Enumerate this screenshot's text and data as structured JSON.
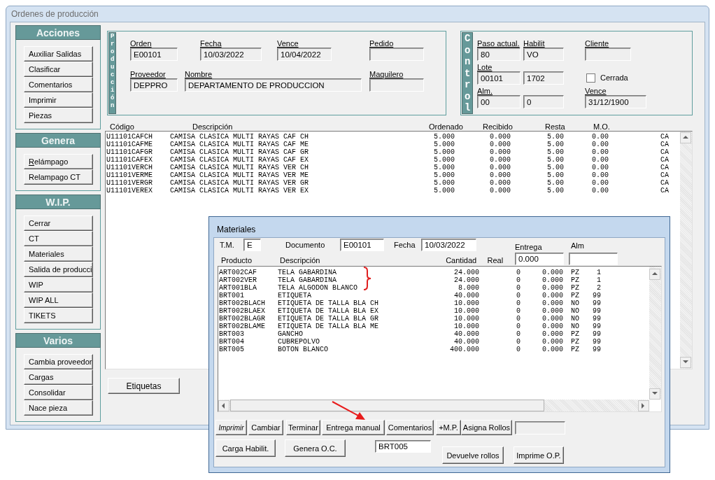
{
  "window": {
    "title": "Ordenes de producción"
  },
  "sidebar": {
    "sections": [
      {
        "title": "Acciones",
        "buttons": [
          {
            "label": "Auxiliar Salidas",
            "mnemonic": false
          },
          {
            "label": "Clasificar",
            "mnemonic": false
          },
          {
            "label": "Comentarios",
            "mnemonic": false
          },
          {
            "label": "Imprimir",
            "mnemonic": false
          },
          {
            "label": "Piezas",
            "mnemonic": false
          }
        ]
      },
      {
        "title": "Genera",
        "buttons": [
          {
            "label": "Relámpago",
            "mnemonic": true
          },
          {
            "label": "Relampago CT",
            "mnemonic": false
          }
        ]
      },
      {
        "title": "W.I.P.",
        "buttons": [
          {
            "label": "Cerrar",
            "mnemonic": false
          },
          {
            "label": "CT",
            "mnemonic": false
          },
          {
            "label": "Materiales",
            "mnemonic": false
          },
          {
            "label": "Salida de producci",
            "mnemonic": false
          },
          {
            "label": "WIP",
            "mnemonic": false
          },
          {
            "label": "WIP ALL",
            "mnemonic": false
          },
          {
            "label": "TIKETS",
            "mnemonic": false
          }
        ]
      },
      {
        "title": "Varios",
        "buttons": [
          {
            "label": "Cambia proveedor",
            "mnemonic": false
          },
          {
            "label": "Cargas",
            "mnemonic": false
          },
          {
            "label": "Consolidar",
            "mnemonic": false
          },
          {
            "label": "Nace pieza",
            "mnemonic": false
          }
        ]
      }
    ]
  },
  "produccion": {
    "label": "Producción",
    "top_fields": [
      {
        "label": "Orden",
        "value": "E00101"
      },
      {
        "label": "Fecha",
        "value": "10/03/2022"
      },
      {
        "label": "Vence",
        "value": "10/04/2022"
      },
      {
        "label": "Pedido"
      }
    ],
    "bottom_fields": [
      {
        "label": "Proveedor",
        "value": "DEPPRO"
      },
      {
        "label": "Nombre",
        "value": "DEPARTAMENTO  DE PRODUCCION"
      },
      {
        "label": "Maquilero"
      }
    ]
  },
  "control": {
    "label": "Control",
    "rows": [
      [
        {
          "kind": "field",
          "label": "Paso actual.",
          "value": "80"
        },
        {
          "kind": "field",
          "label": "Habilit",
          "value": "VO"
        },
        {
          "kind": "field",
          "label": "Cliente"
        }
      ],
      [
        {
          "kind": "field",
          "label": "Lote",
          "value": "00101"
        },
        {
          "kind": "field",
          "value": "1702"
        },
        {
          "kind": "checkbox",
          "label": "Cerrada",
          "checked": false
        }
      ],
      [
        {
          "kind": "field",
          "label": "Alm.",
          "value": "00"
        },
        {
          "kind": "field",
          "value": "0"
        },
        {
          "kind": "field",
          "label": "Vence",
          "value": "31/12/1900"
        }
      ]
    ]
  },
  "table": {
    "columns": [
      "Código",
      "Descripción",
      "Ordenado",
      "Recibido",
      "Resta",
      "M.O."
    ],
    "rows": [
      [
        "U11101CAFCH",
        "CAMISA CLASICA MULTI RAYAS CAF CH",
        "5.000",
        "0.000",
        "5.00",
        "0.00",
        "CA"
      ],
      [
        "U11101CAFME",
        "CAMISA CLASICA MULTI RAYAS CAF ME",
        "5.000",
        "0.000",
        "5.00",
        "0.00",
        "CA"
      ],
      [
        "U11101CAFGR",
        "CAMISA CLASICA MULTI RAYAS CAF GR",
        "5.000",
        "0.000",
        "5.00",
        "0.00",
        "CA"
      ],
      [
        "U11101CAFEX",
        "CAMISA CLASICA MULTI RAYAS CAF EX",
        "5.000",
        "0.000",
        "5.00",
        "0.00",
        "CA"
      ],
      [
        "U11101VERCH",
        "CAMISA CLASICA MULTI RAYAS VER CH",
        "5.000",
        "0.000",
        "5.00",
        "0.00",
        "CA"
      ],
      [
        "U11101VERME",
        "CAMISA CLASICA MULTI RAYAS VER ME",
        "5.000",
        "0.000",
        "5.00",
        "0.00",
        "CA"
      ],
      [
        "U11101VERGR",
        "CAMISA CLASICA MULTI RAYAS VER GR",
        "5.000",
        "0.000",
        "5.00",
        "0.00",
        "CA"
      ],
      [
        "U11101VEREX",
        "CAMISA CLASICA MULTI RAYAS VER EX",
        "5.000",
        "0.000",
        "5.00",
        "0.00",
        "CA"
      ]
    ]
  },
  "footer_button": "Etiquetas",
  "materiales": {
    "title": "Materiales",
    "header": [
      {
        "label": "T.M.",
        "value": "E"
      },
      {
        "label": "Documento",
        "value": "E00101"
      },
      {
        "label": "Fecha",
        "value": "10/03/2022"
      }
    ],
    "entrega": {
      "label": "Entrega",
      "value": "0.000"
    },
    "alm": {
      "label": "Alm"
    },
    "columns": [
      "Producto",
      "Descripción",
      "Cantidad",
      "Real"
    ],
    "rows": [
      [
        "ART002CAF",
        "TELA GABARDINA",
        "24.000",
        "0",
        "0.000",
        "PZ",
        "1"
      ],
      [
        "ART002VER",
        "TELA GABARDINA",
        "24.000",
        "0",
        "0.000",
        "PZ",
        "1"
      ],
      [
        "ART001BLA",
        "TELA ALGODON BLANCO",
        "8.000",
        "0",
        "0.000",
        "PZ",
        "2"
      ],
      [
        "BRT001",
        "ETIQUETA",
        "40.000",
        "0",
        "0.000",
        "PZ",
        "99"
      ],
      [
        "BRT002BLACH",
        "ETIQUETA DE TALLA BLA CH",
        "10.000",
        "0",
        "0.000",
        "NO",
        "99"
      ],
      [
        "BRT002BLAEX",
        "ETIQUETA DE TALLA BLA EX",
        "10.000",
        "0",
        "0.000",
        "NO",
        "99"
      ],
      [
        "BRT002BLAGR",
        "ETIQUETA DE TALLA BLA GR",
        "10.000",
        "0",
        "0.000",
        "NO",
        "99"
      ],
      [
        "BRT002BLAME",
        "ETIQUETA DE TALLA BLA ME",
        "10.000",
        "0",
        "0.000",
        "NO",
        "99"
      ],
      [
        "BRT003",
        "GANCHO",
        "40.000",
        "0",
        "0.000",
        "PZ",
        "99"
      ],
      [
        "BRT004",
        "CUBREPOLVO",
        "40.000",
        "0",
        "0.000",
        "PZ",
        "99"
      ],
      [
        "BRT005",
        "BOTON BLANCO",
        "400.000",
        "0",
        "0.000",
        "PZ",
        "99"
      ]
    ],
    "buttons": [
      {
        "label": "Imprimir",
        "italic": true
      },
      {
        "label": "Cambiar",
        "italic": false
      },
      {
        "label": "Terminar",
        "italic": false
      },
      {
        "label": "Entrega manual",
        "italic": false
      },
      {
        "label": "Comentarios",
        "italic": false
      },
      {
        "label": "+M.P.",
        "italic": false
      },
      {
        "label": "Asigna Rollos",
        "italic": false
      }
    ],
    "row2": [
      {
        "kind": "button",
        "label": "Carga Habilit."
      },
      {
        "kind": "button",
        "label": "Genera O.C."
      },
      {
        "kind": "field",
        "value": "BRT005"
      },
      {
        "kind": "button",
        "label": "Devuelve rollos"
      },
      {
        "kind": "button",
        "label": "Imprime O.P."
      }
    ]
  }
}
